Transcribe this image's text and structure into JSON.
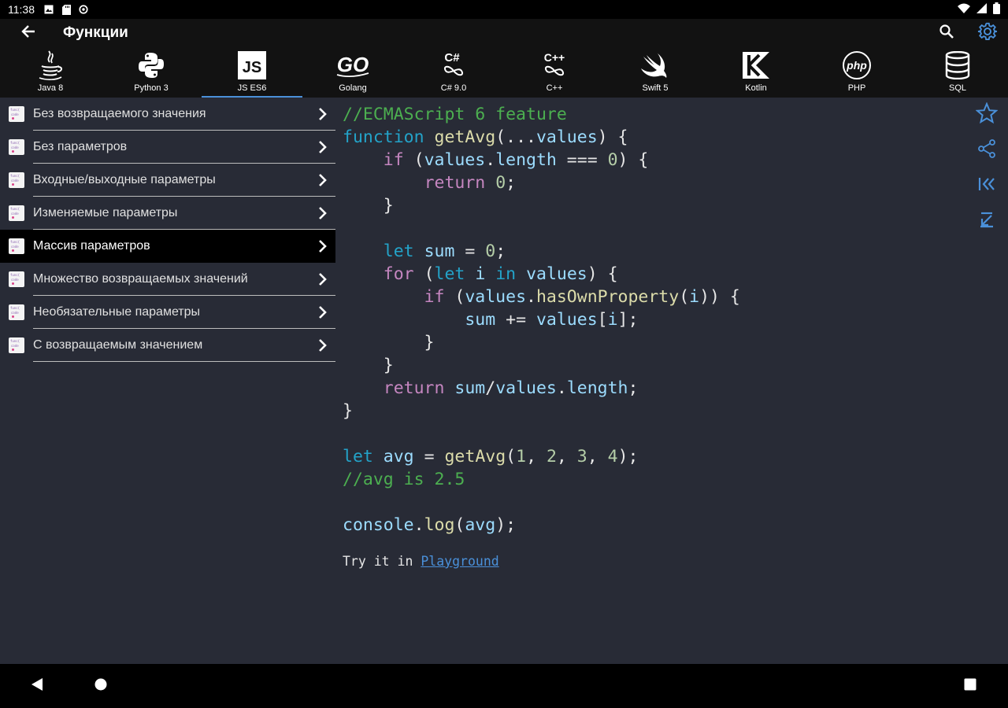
{
  "status": {
    "time": "11:38",
    "left_icons": [
      "photo-icon",
      "sd-card-icon",
      "sync-icon"
    ],
    "right_icons": [
      "wifi-icon",
      "signal-icon",
      "battery-icon"
    ]
  },
  "appbar": {
    "title": "Функции",
    "back_icon": "arrow-left-icon",
    "search_icon": "search-icon",
    "settings_icon": "gear-icon"
  },
  "languages": [
    {
      "label": "Java 8",
      "icon": "java-icon"
    },
    {
      "label": "Python 3",
      "icon": "python-icon"
    },
    {
      "label": "JS ES6",
      "icon": "javascript-icon",
      "badge": "JS",
      "active": true
    },
    {
      "label": "Golang",
      "icon": "golang-icon",
      "badge": "GO"
    },
    {
      "label": "C# 9.0",
      "icon": "csharp-icon",
      "badge": "C#"
    },
    {
      "label": "C++",
      "icon": "cpp-icon",
      "badge": "C++"
    },
    {
      "label": "Swift 5",
      "icon": "swift-icon"
    },
    {
      "label": "Kotlin",
      "icon": "kotlin-icon"
    },
    {
      "label": "PHP",
      "icon": "php-icon",
      "badge": "php"
    },
    {
      "label": "SQL",
      "icon": "database-icon"
    }
  ],
  "topics": {
    "items": [
      {
        "label": "Без возвращаемого значения"
      },
      {
        "label": "Без параметров"
      },
      {
        "label": "Входные/выходные параметры"
      },
      {
        "label": "Изменяемые параметры"
      },
      {
        "label": "Массив параметров",
        "selected": true
      },
      {
        "label": "Множество возвращаемых значений"
      },
      {
        "label": "Необязательные параметры"
      },
      {
        "label": "С возвращаемым значением"
      }
    ],
    "file_icon_text": [
      "func{",
      "code"
    ]
  },
  "code": {
    "lines": [
      [
        [
          "//ECMAScript 6 feature",
          "cm"
        ]
      ],
      [
        [
          "function",
          "kw"
        ],
        [
          " ",
          ""
        ],
        [
          "getAvg",
          "fn"
        ],
        [
          "(...",
          ""
        ],
        [
          "values",
          "vr"
        ],
        [
          ") {",
          ""
        ]
      ],
      [
        [
          "    ",
          ""
        ],
        [
          "if",
          "kp"
        ],
        [
          " (",
          ""
        ],
        [
          "values",
          "vr"
        ],
        [
          ".",
          ""
        ],
        [
          "length",
          "vr"
        ],
        [
          " === ",
          ""
        ],
        [
          "0",
          "nm"
        ],
        [
          ") {",
          ""
        ]
      ],
      [
        [
          "        ",
          ""
        ],
        [
          "return",
          "kp"
        ],
        [
          " ",
          ""
        ],
        [
          "0",
          "nm"
        ],
        [
          ";",
          ""
        ]
      ],
      [
        [
          "    }",
          ""
        ]
      ],
      [
        [
          "",
          ""
        ]
      ],
      [
        [
          "    ",
          ""
        ],
        [
          "let",
          "kw"
        ],
        [
          " ",
          ""
        ],
        [
          "sum",
          "vr"
        ],
        [
          " = ",
          ""
        ],
        [
          "0",
          "nm"
        ],
        [
          ";",
          ""
        ]
      ],
      [
        [
          "    ",
          ""
        ],
        [
          "for",
          "kp"
        ],
        [
          " (",
          ""
        ],
        [
          "let",
          "kw"
        ],
        [
          " ",
          ""
        ],
        [
          "i",
          "vr"
        ],
        [
          " ",
          ""
        ],
        [
          "in",
          "kw"
        ],
        [
          " ",
          ""
        ],
        [
          "values",
          "vr"
        ],
        [
          ") {",
          ""
        ]
      ],
      [
        [
          "        ",
          ""
        ],
        [
          "if",
          "kp"
        ],
        [
          " (",
          ""
        ],
        [
          "values",
          "vr"
        ],
        [
          ".",
          ""
        ],
        [
          "hasOwnProperty",
          "fn"
        ],
        [
          "(",
          ""
        ],
        [
          "i",
          "vr"
        ],
        [
          ")) {",
          ""
        ]
      ],
      [
        [
          "            ",
          ""
        ],
        [
          "sum",
          "vr"
        ],
        [
          " += ",
          ""
        ],
        [
          "values",
          "vr"
        ],
        [
          "[",
          ""
        ],
        [
          "i",
          "vr"
        ],
        [
          "];",
          ""
        ]
      ],
      [
        [
          "        }",
          ""
        ]
      ],
      [
        [
          "    }",
          ""
        ]
      ],
      [
        [
          "    ",
          ""
        ],
        [
          "return",
          "kp"
        ],
        [
          " ",
          ""
        ],
        [
          "sum",
          "vr"
        ],
        [
          "/",
          ""
        ],
        [
          "values",
          "vr"
        ],
        [
          ".",
          ""
        ],
        [
          "length",
          "vr"
        ],
        [
          ";",
          ""
        ]
      ],
      [
        [
          "}",
          ""
        ]
      ],
      [
        [
          "",
          ""
        ]
      ],
      [
        [
          "let",
          "kw"
        ],
        [
          " ",
          ""
        ],
        [
          "avg",
          "vr"
        ],
        [
          " = ",
          ""
        ],
        [
          "getAvg",
          "fn"
        ],
        [
          "(",
          ""
        ],
        [
          "1",
          "nm"
        ],
        [
          ", ",
          ""
        ],
        [
          "2",
          "nm"
        ],
        [
          ", ",
          ""
        ],
        [
          "3",
          "nm"
        ],
        [
          ", ",
          ""
        ],
        [
          "4",
          "nm"
        ],
        [
          ");",
          ""
        ]
      ],
      [
        [
          "//avg is 2.5",
          "cm"
        ]
      ],
      [
        [
          "",
          ""
        ]
      ],
      [
        [
          "console",
          "vr"
        ],
        [
          ".",
          ""
        ],
        [
          "log",
          "fn"
        ],
        [
          "(",
          ""
        ],
        [
          "avg",
          "vr"
        ],
        [
          ");",
          ""
        ]
      ]
    ]
  },
  "tryit": {
    "prefix": "Try it in ",
    "link": "Playground"
  },
  "rail": {
    "icons": [
      "star-icon",
      "share-icon",
      "first-page-icon",
      "last-page-icon"
    ]
  },
  "navbar": {
    "icons": [
      "back-triangle-icon",
      "home-circle-icon",
      "recents-square-icon"
    ]
  },
  "colors": {
    "accent": "#4a90d9",
    "background": "#282b36",
    "bar": "#121212"
  }
}
